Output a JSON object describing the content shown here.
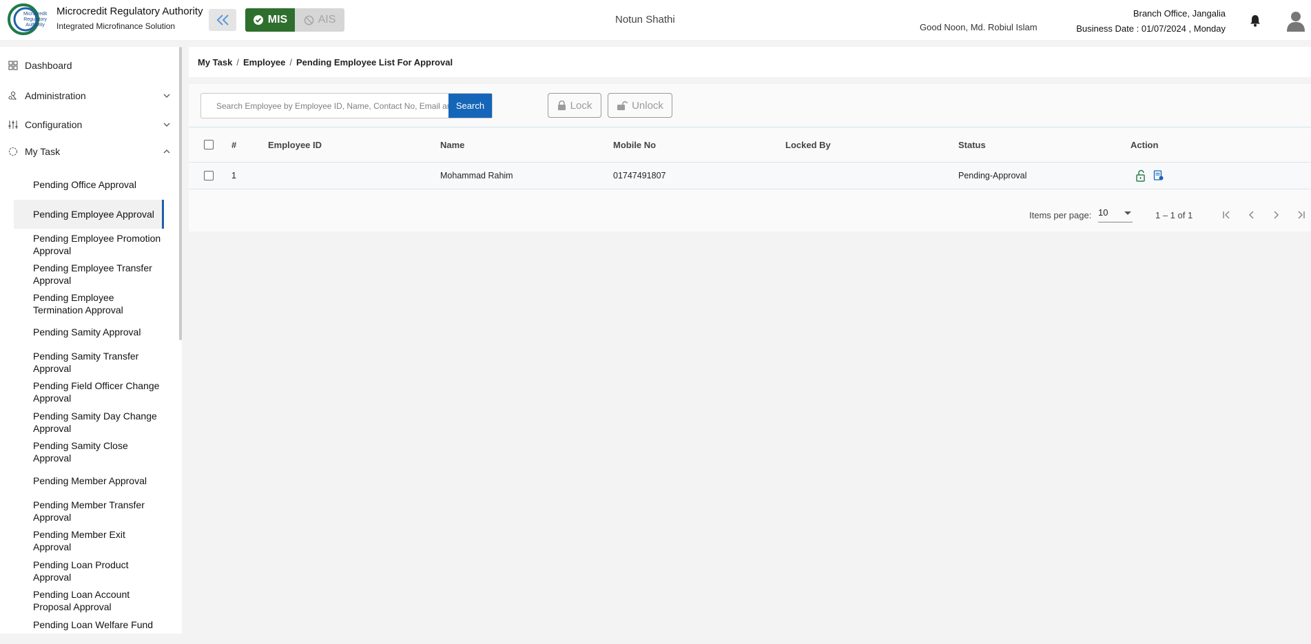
{
  "header": {
    "org_title": "Microcredit Regulatory Authority",
    "org_subtitle": "Integrated Microfinance Solution",
    "logo_lines": [
      "Microcredit",
      "Regulatory",
      "Authority"
    ],
    "mode_mis": "MIS",
    "mode_ais": "AIS",
    "app_title": "Notun Shathi",
    "greeting": "Good Noon, Md. Robiul Islam",
    "branch": "Branch Office, Jangalia",
    "business_date": "Business Date : 01/07/2024 , Monday"
  },
  "sidebar": {
    "top_items": [
      {
        "label": "Dashboard",
        "icon": "grid-icon"
      },
      {
        "label": "Administration",
        "icon": "users-icon"
      },
      {
        "label": "Configuration",
        "icon": "sliders-icon"
      },
      {
        "label": "My Task",
        "icon": "task-icon"
      }
    ],
    "sub_items": [
      "Pending Office Approval",
      "Pending Employee Approval",
      "Pending Employee Promotion Approval",
      "Pending Employee Transfer Approval",
      "Pending Employee Termination Approval",
      "Pending Samity Approval",
      "Pending Samity Transfer Approval",
      "Pending Field Officer Change Approval",
      "Pending Samity Day Change Approval",
      "Pending Samity Close Approval",
      "Pending Member Approval",
      "Pending Member Transfer Approval",
      "Pending Member Exit Approval",
      "Pending Loan Product Approval",
      "Pending Loan Account Proposal Approval",
      "Pending Loan Welfare Fund Approval"
    ],
    "active_index": 1
  },
  "breadcrumb": {
    "items": [
      "My Task",
      "Employee",
      "Pending Employee List For Approval"
    ]
  },
  "search": {
    "placeholder": "Search Employee by Employee ID, Name, Contact No, Email and Status",
    "button": "Search"
  },
  "toolbar": {
    "lock": "Lock",
    "unlock": "Unlock"
  },
  "table": {
    "columns": [
      "#",
      "Employee ID",
      "Name",
      "Mobile No",
      "Locked By",
      "Status",
      "Action"
    ],
    "rows": [
      {
        "index": "1",
        "employee_id": "",
        "name": "Mohammad Rahim",
        "mobile": "01747491807",
        "locked_by": "",
        "status": "Pending-Approval"
      }
    ]
  },
  "paginator": {
    "label": "Items per page:",
    "page_size": "10",
    "range": "1 – 1 of 1"
  },
  "colors": {
    "mis_green": "#2e6f2e",
    "primary_blue": "#1565b8",
    "action_green": "#2e7d4f"
  }
}
